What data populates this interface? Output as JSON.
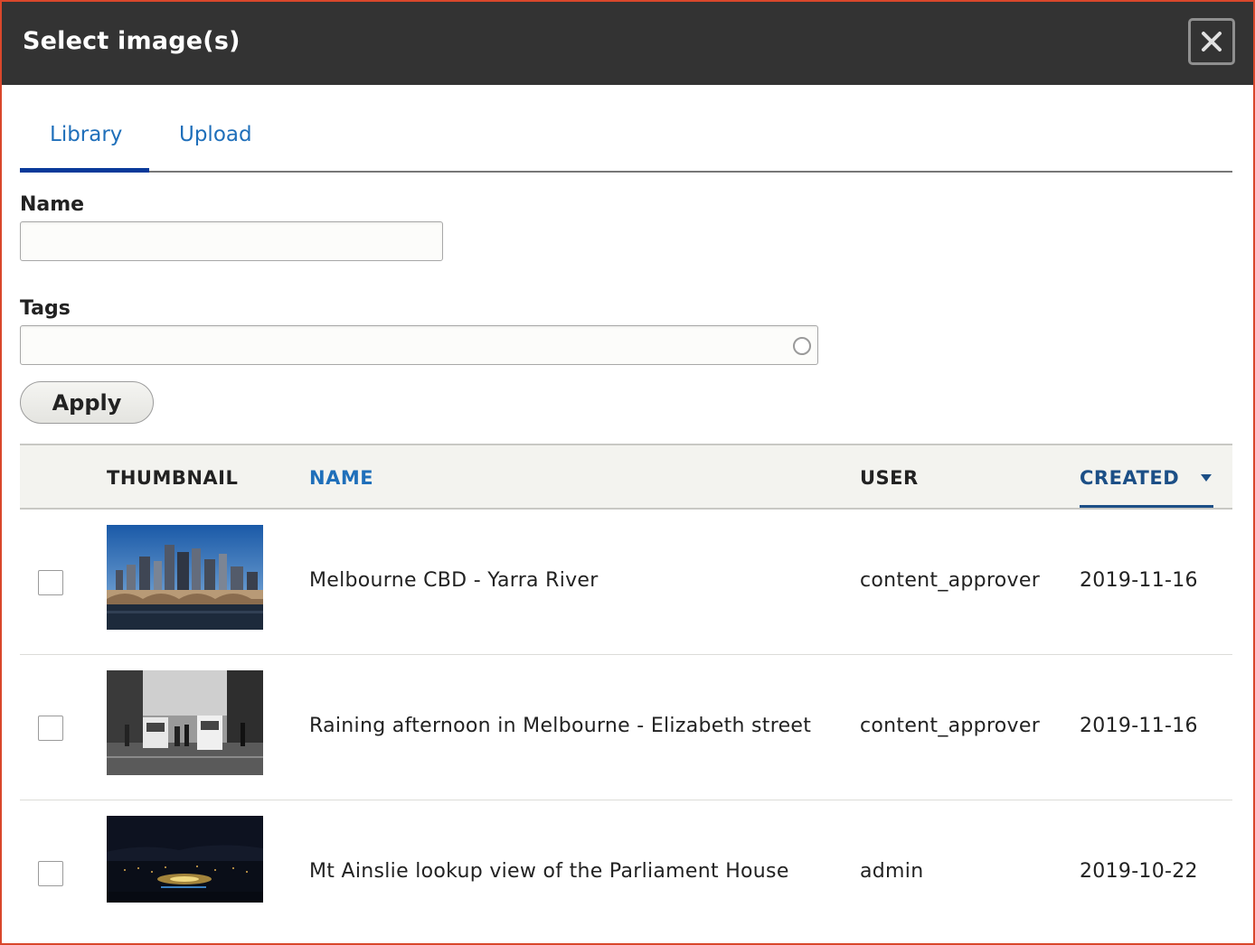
{
  "dialog": {
    "title": "Select image(s)",
    "close_icon": "close-icon"
  },
  "tabs": [
    {
      "label": "Library",
      "active": true
    },
    {
      "label": "Upload",
      "active": false
    }
  ],
  "filters": {
    "name_label": "Name",
    "name_value": "",
    "tags_label": "Tags",
    "tags_value": "",
    "apply_label": "Apply"
  },
  "table": {
    "headers": {
      "thumbnail": "THUMBNAIL",
      "name": "NAME",
      "user": "USER",
      "created": "CREATED"
    },
    "sort": {
      "column": "created",
      "direction": "desc"
    },
    "rows": [
      {
        "name": "Melbourne CBD - Yarra River",
        "user": "content_approver",
        "created": "2019-11-16",
        "thumbnail": "city-skyline-river"
      },
      {
        "name": "Raining afternoon in Melbourne - Elizabeth street",
        "user": "content_approver",
        "created": "2019-11-16",
        "thumbnail": "rainy-street-bw"
      },
      {
        "name": "Mt Ainslie lookup view of the Parliament House",
        "user": "admin",
        "created": "2019-10-22",
        "thumbnail": "night-city-view"
      }
    ]
  },
  "colors": {
    "titlebar": "#333333",
    "link": "#1f6fba",
    "active_tab": "#0a3a9a",
    "dialog_border": "#d9472b"
  }
}
